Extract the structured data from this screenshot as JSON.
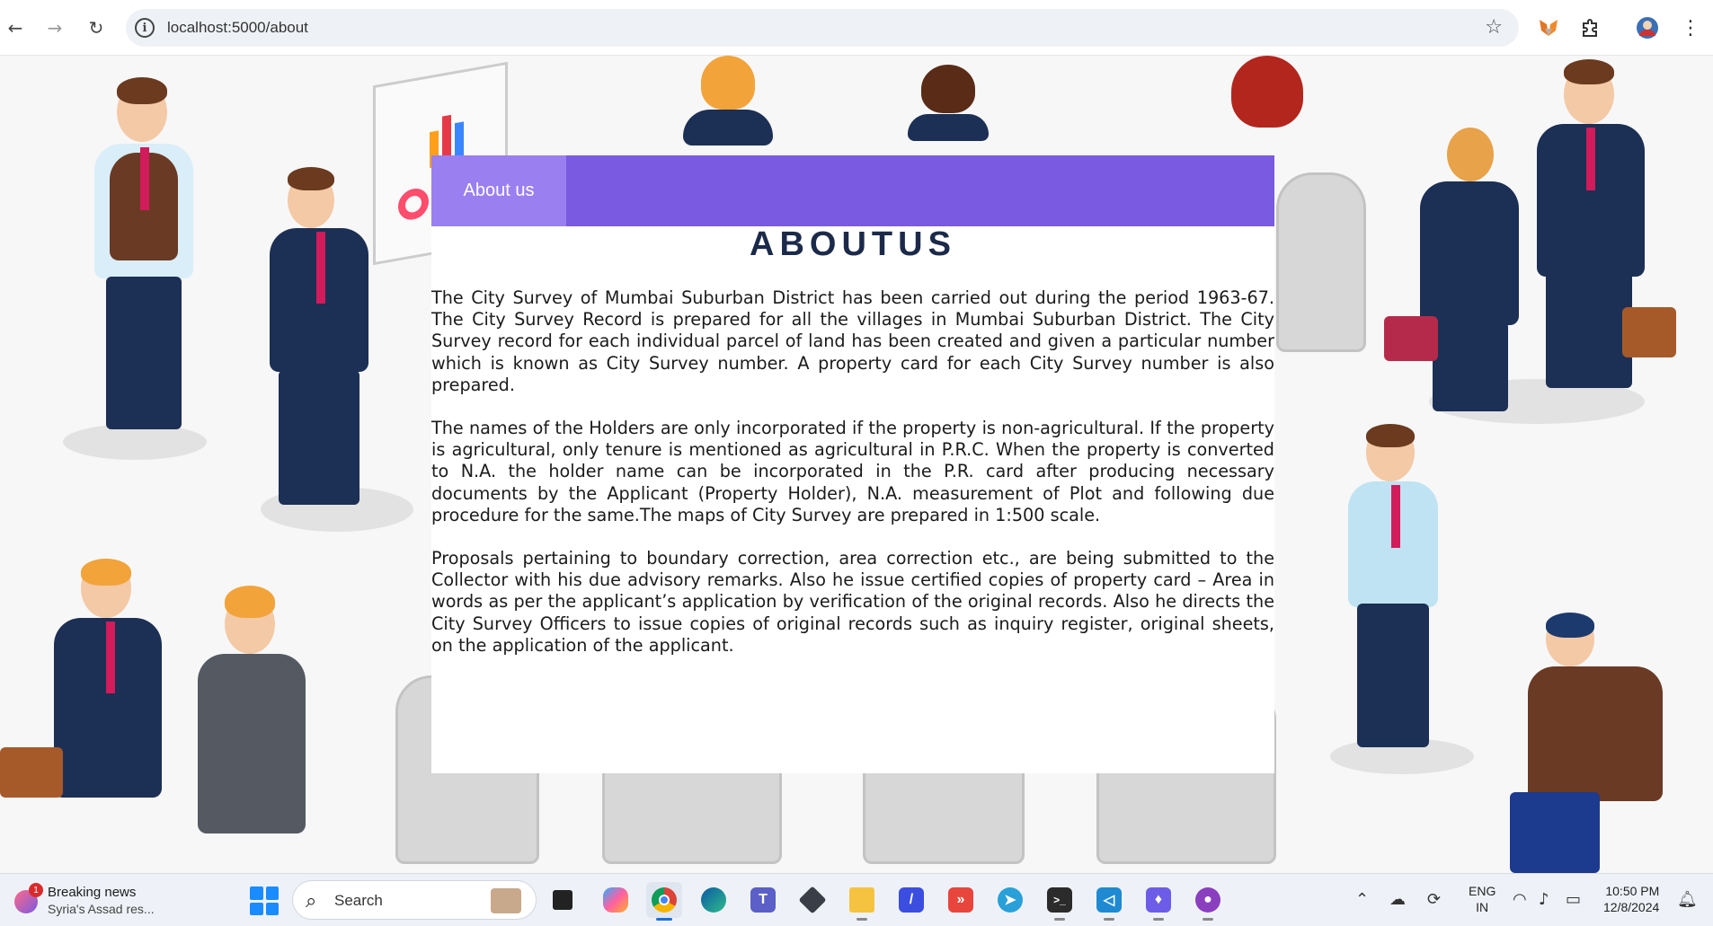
{
  "browser": {
    "url": "localhost:5000/about",
    "back_icon": "←",
    "forward_icon": "→",
    "reload_icon": "↻",
    "info_icon": "i",
    "star_icon": "☆",
    "menu_icon": "⋮"
  },
  "page": {
    "tab_label": "About us",
    "heading": "ABOUTUS",
    "paragraphs": [
      "The City Survey of Mumbai Suburban District has been carried out during the period 1963-67. The City Survey Record is prepared for all the villages in Mumbai Suburban District. The City Survey record for each individual parcel of land has been created and given a particular number which is known as City Survey number. A property card for each City Survey number is also prepared.",
      "The names of the Holders are only incorporated if the property is non-agricultural. If the property is agricultural, only tenure is mentioned as agricultural in P.R.C. When the property is converted to N.A. the holder name can be incorporated in the P.R. card after producing necessary documents by the Applicant (Property Holder), N.A. measurement of Plot and following due procedure for the same.The maps of City Survey are prepared in 1:500 scale.",
      "Proposals pertaining to boundary correction, area correction etc., are being submitted to the Collector with his due advisory remarks. Also he issue certified copies of property card – Area in words as per the applicant’s application by verification of the original records. Also he directs the City Survey Officers to issue copies of original records such as inquiry register, original sheets, on the application of the applicant."
    ],
    "colors": {
      "tab_bar": "#7a5ae0",
      "tab_active": "#9a7ff0",
      "heading": "#1c2a4a"
    }
  },
  "taskbar": {
    "news_title": "Breaking news",
    "news_subtitle": "Syria's Assad res...",
    "news_badge": "1",
    "search_label": "Search",
    "language_top": "ENG",
    "language_bottom": "IN",
    "time": "10:50 PM",
    "date": "12/8/2024",
    "apps": [
      "task-view",
      "copilot",
      "chrome",
      "edge",
      "teams",
      "unity",
      "file-explorer",
      "app-a",
      "app-b",
      "telegram",
      "terminal",
      "vscode",
      "app-c",
      "github-desktop"
    ]
  }
}
